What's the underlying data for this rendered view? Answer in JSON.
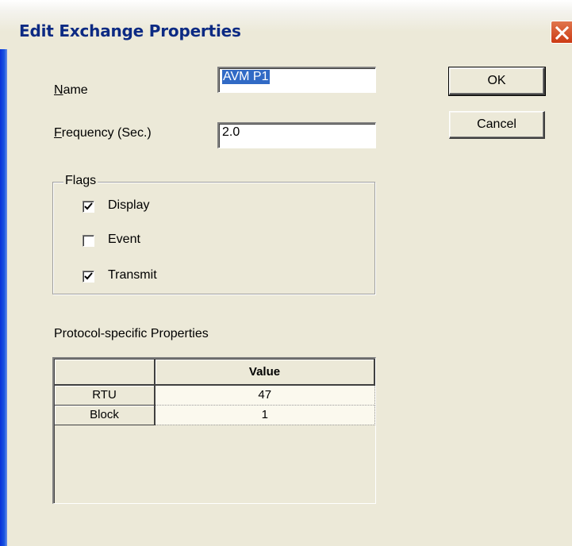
{
  "window": {
    "title": "Edit Exchange Properties"
  },
  "fields": {
    "name": {
      "label_accel": "N",
      "label_rest": "ame",
      "value": "AVM P1"
    },
    "frequency": {
      "label_accel": "F",
      "label_rest": "requency (Sec.)",
      "value": "2.0"
    }
  },
  "buttons": {
    "ok": "OK",
    "cancel": "Cancel"
  },
  "flags": {
    "legend": "Flags",
    "items": [
      {
        "label": "Display",
        "checked": true
      },
      {
        "label": "Event",
        "checked": false
      },
      {
        "label": "Transmit",
        "checked": true
      }
    ]
  },
  "protocol": {
    "title": "Protocol-specific Properties",
    "columns": [
      "",
      "Value"
    ],
    "rows": [
      {
        "name": "RTU",
        "value": "47"
      },
      {
        "name": "Block",
        "value": "1"
      }
    ]
  },
  "colors": {
    "titlebar_text": "#0c2a83",
    "close_button": "#d8542c",
    "selection": "#316ac5",
    "window_face": "#ece9d8"
  }
}
